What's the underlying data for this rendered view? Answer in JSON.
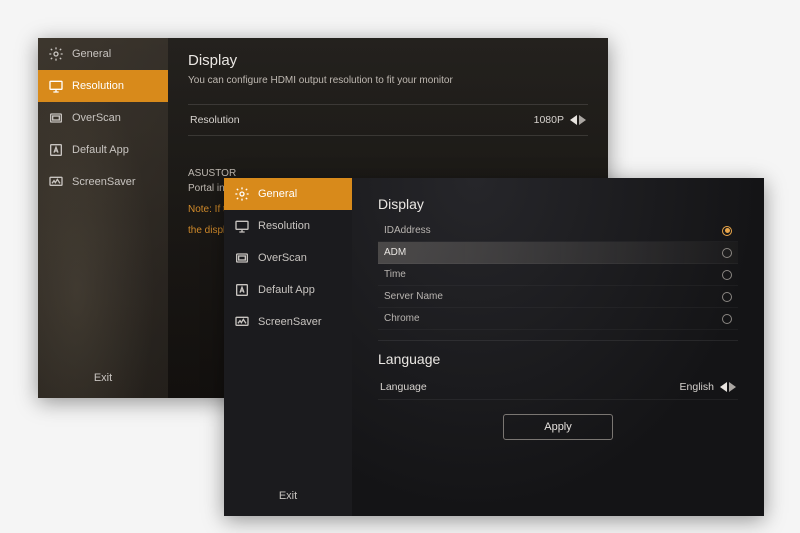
{
  "colors": {
    "accent": "#d88a1b",
    "radio_checked": "#e9a64a"
  },
  "back": {
    "sidebar": {
      "items": [
        {
          "label": "General",
          "icon": "gear",
          "active": false
        },
        {
          "label": "Resolution",
          "icon": "monitor",
          "active": true
        },
        {
          "label": "OverScan",
          "icon": "overscan",
          "active": false
        },
        {
          "label": "Default App",
          "icon": "letter-a",
          "active": false
        },
        {
          "label": "ScreenSaver",
          "icon": "screensaver",
          "active": false
        }
      ],
      "exit": "Exit"
    },
    "title": "Display",
    "desc": "You can configure  HDMI output resolution to  fit your monitor",
    "resolution": {
      "label": "Resolution",
      "value": "1080P"
    },
    "asustor_line": "ASUSTOR",
    "portal_line": "Portal inte",
    "note_line": "Note: If the",
    "note_line2": "the display"
  },
  "front": {
    "sidebar": {
      "items": [
        {
          "label": "General",
          "icon": "gear",
          "active": true
        },
        {
          "label": "Resolution",
          "icon": "monitor",
          "active": false
        },
        {
          "label": "OverScan",
          "icon": "overscan",
          "active": false
        },
        {
          "label": "Default App",
          "icon": "letter-a",
          "active": false
        },
        {
          "label": "ScreenSaver",
          "icon": "screensaver",
          "active": false
        }
      ],
      "exit": "Exit"
    },
    "display_title": "Display",
    "display_options": [
      {
        "label": "IDAddress",
        "checked": true,
        "highlight": false
      },
      {
        "label": "ADM",
        "checked": false,
        "highlight": true
      },
      {
        "label": "Time",
        "checked": false,
        "highlight": false
      },
      {
        "label": "Server Name",
        "checked": false,
        "highlight": false
      },
      {
        "label": "Chrome",
        "checked": false,
        "highlight": false
      }
    ],
    "language_title": "Language",
    "language": {
      "label": "Language",
      "value": "English"
    },
    "apply": "Apply"
  }
}
